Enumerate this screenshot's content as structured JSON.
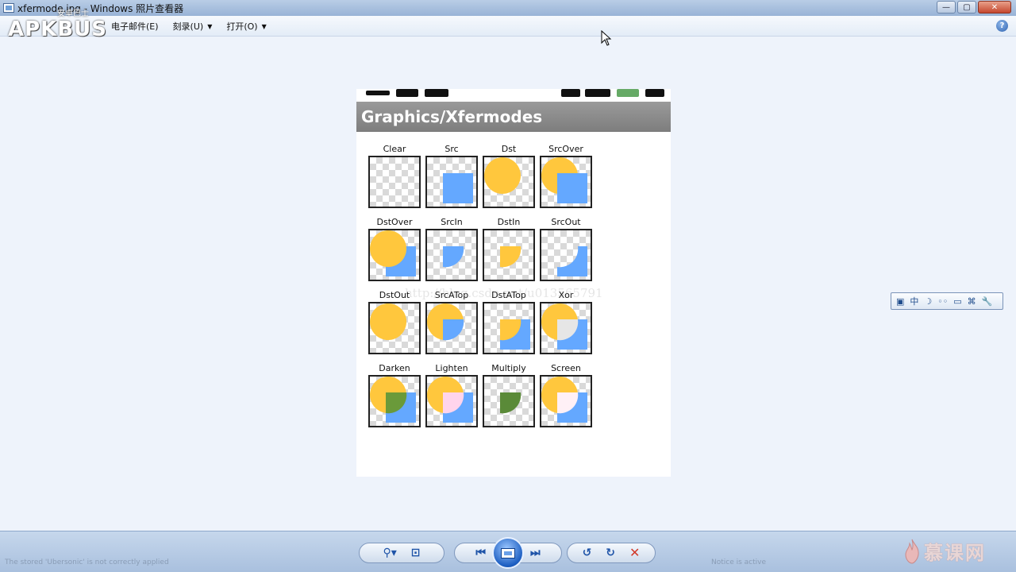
{
  "window": {
    "title": "xfermode.jpg - Windows 照片查看器",
    "buttons": {
      "minimize": "—",
      "maximize": "▢",
      "close": "✕"
    }
  },
  "watermark_logo": {
    "main": "APKBUS",
    "sub": "安卓巴士"
  },
  "menu": {
    "items": [
      {
        "label": "电子邮件(E)",
        "has_caret": false
      },
      {
        "label": "刻录(U)",
        "has_caret": true
      },
      {
        "label": "打开(O)",
        "has_caret": true
      }
    ],
    "help_label": "?"
  },
  "phone": {
    "header_title": "Graphics/Xfermodes",
    "modes": [
      "Clear",
      "Src",
      "Dst",
      "SrcOver",
      "DstOver",
      "SrcIn",
      "DstIn",
      "SrcOut",
      "DstOut",
      "SrcATop",
      "DstATop",
      "Xor",
      "Darken",
      "Lighten",
      "Multiply",
      "Screen"
    ],
    "colors": {
      "dst_circle": "#ffc73d",
      "src_square": "#64a8ff",
      "darken": "#6a9a3a",
      "lighten": "#ffd4ec",
      "multiply": "#5a8a38",
      "screen": "#fff0f6"
    }
  },
  "overlay_watermark": "http://blog.csdn.net/u013565791",
  "ime_toolbar": {
    "items": [
      "▣",
      "中",
      "☽",
      "◦◦",
      "▭",
      "⌘",
      "🔧"
    ]
  },
  "bottom_toolbar": {
    "zoom_label": "⚲▾",
    "fit_label": "⊡",
    "prev_label": "⏮",
    "next_label": "⏭",
    "rotate_ccw_label": "↺",
    "rotate_cw_label": "↻",
    "delete_label": "✕",
    "status_left": "The stored 'Ubersonic' is not correctly applied",
    "status_right": "Notice is active"
  },
  "brand": {
    "text": "慕课网"
  }
}
